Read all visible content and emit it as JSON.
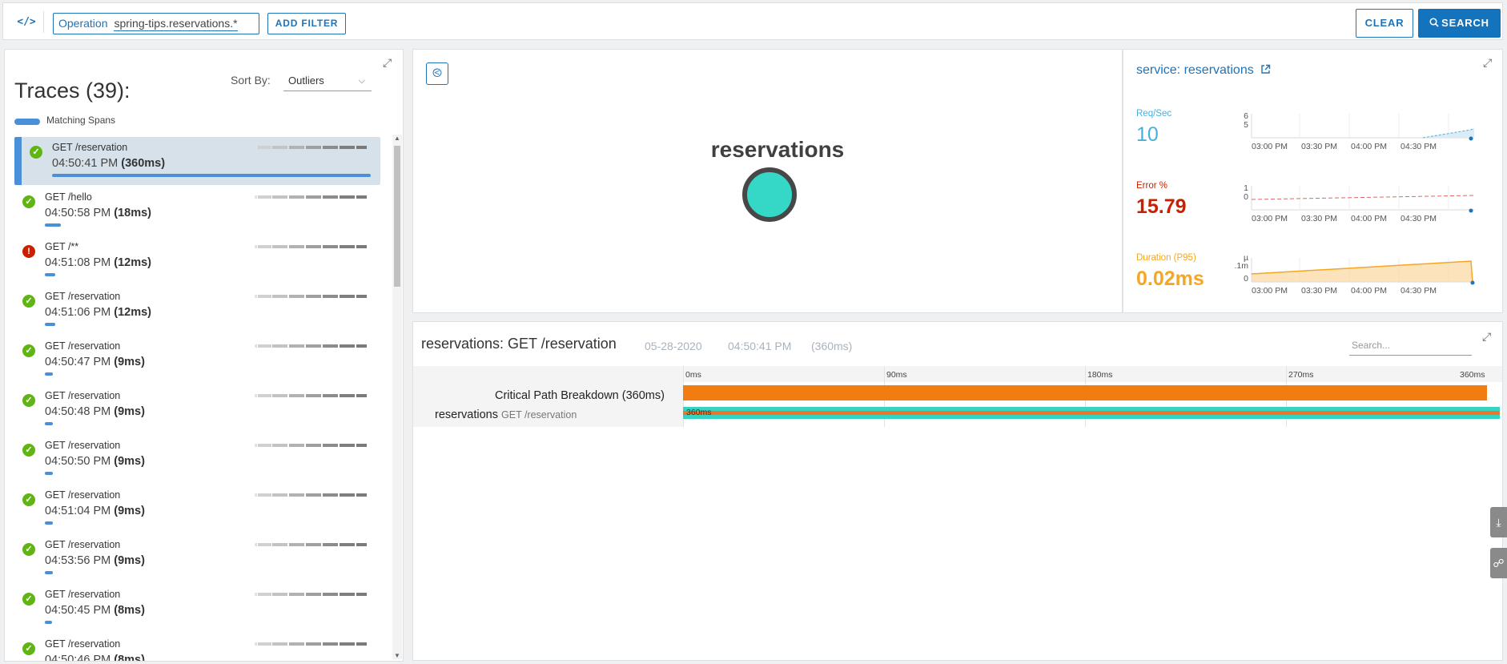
{
  "toolbar": {
    "code_icon": "</>",
    "filter": {
      "key": "Operation",
      "value": "spring-tips.reservations.*"
    },
    "add_filter": "ADD FILTER",
    "clear": "CLEAR",
    "search": "SEARCH"
  },
  "traces": {
    "title": "Traces (39):",
    "sort_label": "Sort By:",
    "sort_value": "Outliers",
    "legend": "Matching Spans",
    "items": [
      {
        "op": "GET /reservation",
        "time": "04:50:41 PM",
        "dur": "(360ms)",
        "status": "ok",
        "bar_fraction": 1.0
      },
      {
        "op": "GET /hello",
        "time": "04:50:58 PM",
        "dur": "(18ms)",
        "status": "ok",
        "bar_fraction": 0.05
      },
      {
        "op": "GET /**",
        "time": "04:51:08 PM",
        "dur": "(12ms)",
        "status": "error",
        "bar_fraction": 0.033
      },
      {
        "op": "GET /reservation",
        "time": "04:51:06 PM",
        "dur": "(12ms)",
        "status": "ok",
        "bar_fraction": 0.033
      },
      {
        "op": "GET /reservation",
        "time": "04:50:47 PM",
        "dur": "(9ms)",
        "status": "ok",
        "bar_fraction": 0.025
      },
      {
        "op": "GET /reservation",
        "time": "04:50:48 PM",
        "dur": "(9ms)",
        "status": "ok",
        "bar_fraction": 0.025
      },
      {
        "op": "GET /reservation",
        "time": "04:50:50 PM",
        "dur": "(9ms)",
        "status": "ok",
        "bar_fraction": 0.025
      },
      {
        "op": "GET /reservation",
        "time": "04:51:04 PM",
        "dur": "(9ms)",
        "status": "ok",
        "bar_fraction": 0.025
      },
      {
        "op": "GET /reservation",
        "time": "04:53:56 PM",
        "dur": "(9ms)",
        "status": "ok",
        "bar_fraction": 0.025
      },
      {
        "op": "GET /reservation",
        "time": "04:50:45 PM",
        "dur": "(8ms)",
        "status": "ok",
        "bar_fraction": 0.022
      },
      {
        "op": "GET /reservation",
        "time": "04:50:46 PM",
        "dur": "(8ms)",
        "status": "ok",
        "bar_fraction": 0.022
      }
    ]
  },
  "service_map": {
    "node": "reservations"
  },
  "service_stats": {
    "title": "service: reservations",
    "metrics": [
      {
        "label": "Req/Sec",
        "value": "10",
        "color": "#49afd9",
        "y_ticks": [
          "6",
          "5"
        ]
      },
      {
        "label": "Error %",
        "value": "15.79",
        "color": "#c92100",
        "y_ticks": [
          "1",
          "0"
        ]
      },
      {
        "label": "Duration (P95)",
        "value": "0.02ms",
        "color": "#f5a623",
        "y_ticks": [
          "µ",
          ".1m",
          "0"
        ]
      }
    ],
    "x_ticks": [
      "03:00 PM",
      "03:30 PM",
      "04:00 PM",
      "04:30 PM"
    ]
  },
  "detail": {
    "title": "reservations: GET /reservation",
    "date": "05-28-2020",
    "time": "04:50:41 PM",
    "duration": "(360ms)",
    "search_placeholder": "Search...",
    "ticks": [
      "0ms",
      "90ms",
      "180ms",
      "270ms",
      "360ms"
    ],
    "critical_path": "Critical Path Breakdown (360ms)",
    "span_service": "reservations",
    "span_op": "GET /reservation",
    "span_duration": "360ms"
  },
  "colors": {
    "accent": "#1373bd",
    "ok": "#60b515",
    "error": "#c92100",
    "critical_path": "#f27c0f",
    "span": "#36d2c2",
    "node": "#35d8c6"
  }
}
